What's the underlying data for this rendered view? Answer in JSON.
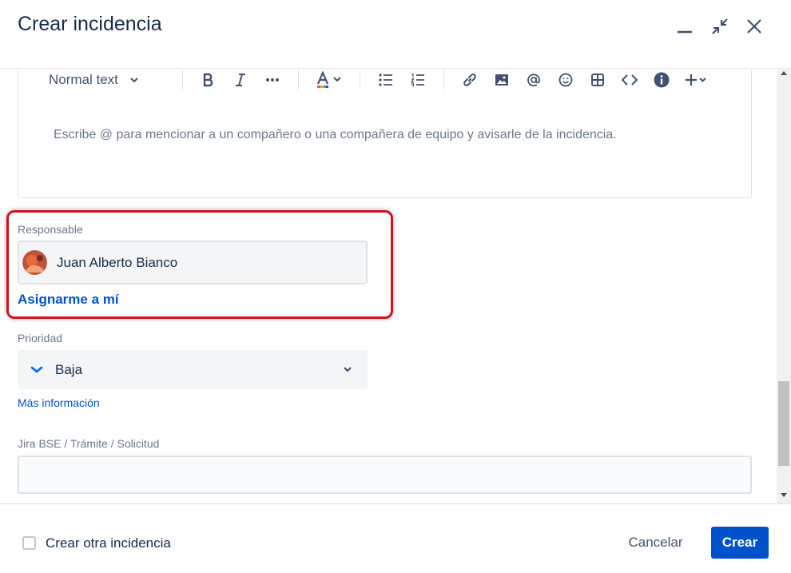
{
  "dialog": {
    "title": "Crear incidencia"
  },
  "header_icons": [
    "minimize-icon",
    "collapse-icon",
    "close-icon"
  ],
  "editor": {
    "text_style": "Normal text",
    "placeholder": "Escribe @ para mencionar a un compañero o una compañera de equipo y avisarle de la incidencia.",
    "toolbar_icons": [
      "bold-icon",
      "italic-icon",
      "more-icon",
      "text-color-icon",
      "bullet-list-icon",
      "numbered-list-icon",
      "link-icon",
      "image-icon",
      "mention-icon",
      "emoji-icon",
      "table-icon",
      "code-icon",
      "info-icon",
      "insert-plus-icon"
    ]
  },
  "responsable": {
    "label": "Responsable",
    "value": "Juan Alberto Bianco",
    "assign_me": "Asignarme a mí"
  },
  "prioridad": {
    "label": "Prioridad",
    "value": "Baja",
    "more_info": "Más información"
  },
  "jira": {
    "label": "Jira BSE / Trámite / Solicitud",
    "value": ""
  },
  "footer": {
    "checkbox_label": "Crear otra incidencia",
    "cancel": "Cancelar",
    "create": "Crear"
  },
  "colors": {
    "primary": "#0052cc",
    "text": "#172b4d",
    "highlight": "#d0121b",
    "text_color_bar": [
      "#ff5630",
      "#ffab00",
      "#36b37e",
      "#0065ff"
    ]
  }
}
